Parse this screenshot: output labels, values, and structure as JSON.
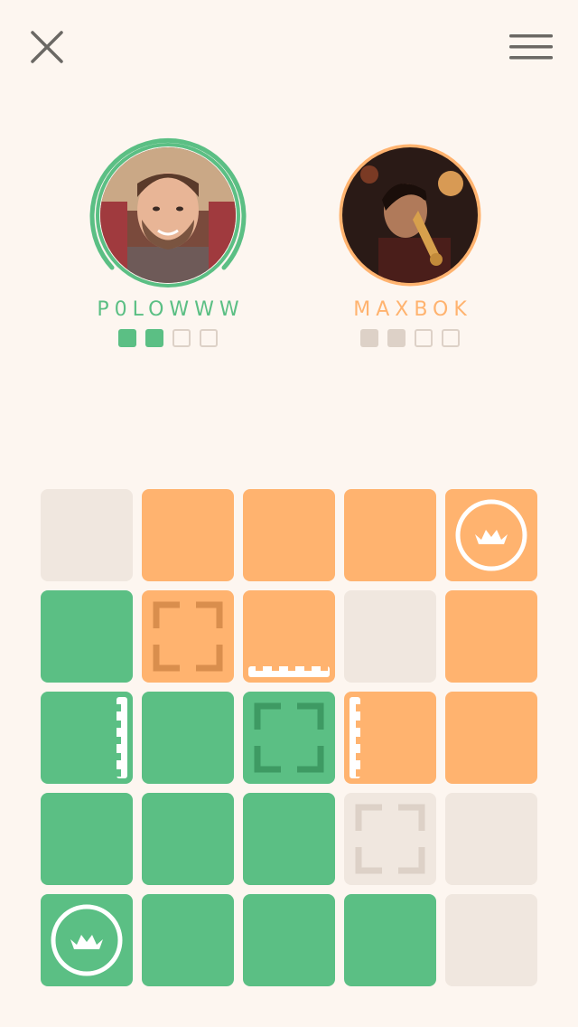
{
  "colors": {
    "background": "#fdf6f0",
    "green": "#5bbf84",
    "green_dark": "#3e9a63",
    "orange": "#ffb36f",
    "orange_dark": "#d98e4d",
    "neutral": "#f0e7df",
    "neutral_dark": "#ddd1c7",
    "icon": "#6b6864"
  },
  "header": {
    "close_icon": "close-icon",
    "menu_icon": "hamburger-menu-icon"
  },
  "players": [
    {
      "name": "P0LOWWW",
      "color": "#5bbf84",
      "active": true,
      "score": [
        true,
        true,
        false,
        false
      ]
    },
    {
      "name": "MAXBOK",
      "color": "#ffb36f",
      "active": false,
      "score": [
        true,
        true,
        false,
        false
      ]
    }
  ],
  "board": {
    "rows": [
      [
        {
          "owner": "neutral",
          "mark": "none"
        },
        {
          "owner": "orange",
          "mark": "none"
        },
        {
          "owner": "orange",
          "mark": "none"
        },
        {
          "owner": "orange",
          "mark": "none"
        },
        {
          "owner": "orange",
          "mark": "crown"
        }
      ],
      [
        {
          "owner": "green",
          "mark": "none"
        },
        {
          "owner": "orange",
          "mark": "corners"
        },
        {
          "owner": "orange",
          "mark": "edge-bottom"
        },
        {
          "owner": "neutral",
          "mark": "none"
        },
        {
          "owner": "orange",
          "mark": "none"
        }
      ],
      [
        {
          "owner": "green",
          "mark": "edge-right"
        },
        {
          "owner": "green",
          "mark": "none"
        },
        {
          "owner": "green",
          "mark": "corners"
        },
        {
          "owner": "orange",
          "mark": "edge-left"
        },
        {
          "owner": "orange",
          "mark": "none"
        }
      ],
      [
        {
          "owner": "green",
          "mark": "none"
        },
        {
          "owner": "green",
          "mark": "none"
        },
        {
          "owner": "green",
          "mark": "none"
        },
        {
          "owner": "neutral",
          "mark": "corners"
        },
        {
          "owner": "neutral",
          "mark": "none"
        }
      ],
      [
        {
          "owner": "green",
          "mark": "crown"
        },
        {
          "owner": "green",
          "mark": "none"
        },
        {
          "owner": "green",
          "mark": "none"
        },
        {
          "owner": "green",
          "mark": "none"
        },
        {
          "owner": "neutral",
          "mark": "none"
        }
      ]
    ]
  }
}
